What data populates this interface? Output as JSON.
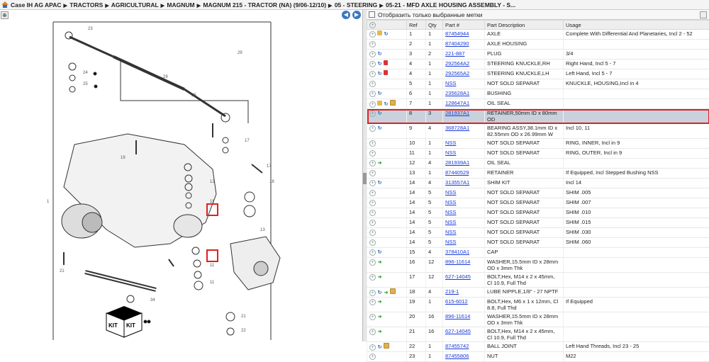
{
  "breadcrumb": [
    "Case IH AG APAC",
    "TRACTORS",
    "AGRICULTURAL",
    "MAGNUM",
    "MAGNUM 215 - TRACTOR (NA) (9/06-12/10)",
    "05 - STEERING",
    "05-21 - MFD AXLE HOUSING ASSEMBLY - S..."
  ],
  "filter_label": "Отобразить только выбранные метки",
  "columns": [
    "",
    "Ref",
    "Qty",
    "Part #",
    "Part Description",
    "Usage"
  ],
  "rows": [
    {
      "icons": [
        "folder",
        "blue"
      ],
      "ref": "1",
      "qty": "1",
      "part": "87454944",
      "desc": "AXLE",
      "usage": "Complete With Differential And Planetaries, Incl 2 - 52"
    },
    {
      "icons": [],
      "ref": "2",
      "qty": "1",
      "part": "87404290",
      "desc": "AXLE HOUSING",
      "usage": ""
    },
    {
      "icons": [
        "blue"
      ],
      "ref": "3",
      "qty": "2",
      "part": "221-887",
      "desc": "PLUG",
      "usage": "3/4"
    },
    {
      "icons": [
        "blue",
        "doc"
      ],
      "ref": "4",
      "qty": "1",
      "part": "292564A2",
      "desc": "STEERING KNUCKLE,RH",
      "usage": "Right Hand, Incl 5 - 7"
    },
    {
      "icons": [
        "blue",
        "doc"
      ],
      "ref": "4",
      "qty": "1",
      "part": "292565A2",
      "desc": "STEERING KNUCKLE,LH",
      "usage": "Left Hand, Incl 5 - 7"
    },
    {
      "icons": [],
      "ref": "5",
      "qty": "1",
      "part": "NSS",
      "desc": "NOT SOLD SEPARAT",
      "usage": "KNUCKLE, HOUSING,Incl in 4"
    },
    {
      "icons": [
        "blue"
      ],
      "ref": "6",
      "qty": "1",
      "part": "235628A1",
      "desc": "BUSHING",
      "usage": ""
    },
    {
      "icons": [
        "folder",
        "blue",
        "box"
      ],
      "ref": "7",
      "qty": "1",
      "part": "128647A1",
      "desc": "OIL SEAL",
      "usage": ""
    },
    {
      "icons": [
        "blue"
      ],
      "ref": "8",
      "qty": "3",
      "part": "281937A1",
      "desc": "RETAINER,50mm ID x 80mm OD",
      "usage": "",
      "selected": true
    },
    {
      "icons": [
        "blue"
      ],
      "ref": "9",
      "qty": "4",
      "part": "368728A1",
      "desc": "BEARING ASSY,38.1mm ID x 82.55mm OD x 26.99mm W",
      "usage": "Incl 10, 11"
    },
    {
      "icons": [],
      "ref": "10",
      "qty": "1",
      "part": "NSS",
      "desc": "NOT SOLD SEPARAT",
      "usage": "RING, INNER, Incl in 9"
    },
    {
      "icons": [],
      "ref": "11",
      "qty": "1",
      "part": "NSS",
      "desc": "NOT SOLD SEPARAT",
      "usage": "RING, OUTER, Incl in 9"
    },
    {
      "icons": [
        "green"
      ],
      "ref": "12",
      "qty": "4",
      "part": "281939A1",
      "desc": "OIL SEAL",
      "usage": ""
    },
    {
      "icons": [],
      "ref": "13",
      "qty": "1",
      "part": "87440529",
      "desc": "RETAINER",
      "usage": "If Equipped, Incl Stepped Bushing NSS"
    },
    {
      "icons": [
        "blue"
      ],
      "ref": "14",
      "qty": "4",
      "part": "313557A1",
      "desc": "SHIM KIT",
      "usage": "Incl 14"
    },
    {
      "icons": [],
      "ref": "14",
      "qty": "5",
      "part": "NSS",
      "desc": "NOT SOLD SEPARAT",
      "usage": "SHIM .005"
    },
    {
      "icons": [],
      "ref": "14",
      "qty": "5",
      "part": "NSS",
      "desc": "NOT SOLD SEPARAT",
      "usage": "SHIM .007"
    },
    {
      "icons": [],
      "ref": "14",
      "qty": "5",
      "part": "NSS",
      "desc": "NOT SOLD SEPARAT",
      "usage": "SHIM .010"
    },
    {
      "icons": [],
      "ref": "14",
      "qty": "5",
      "part": "NSS",
      "desc": "NOT SOLD SEPARAT",
      "usage": "SHIM .015"
    },
    {
      "icons": [],
      "ref": "14",
      "qty": "5",
      "part": "NSS",
      "desc": "NOT SOLD SEPARAT",
      "usage": "SHIM .030"
    },
    {
      "icons": [],
      "ref": "14",
      "qty": "5",
      "part": "NSS",
      "desc": "NOT SOLD SEPARAT",
      "usage": "SHIM .060"
    },
    {
      "icons": [
        "blue"
      ],
      "ref": "15",
      "qty": "4",
      "part": "378410A1",
      "desc": "CAP",
      "usage": ""
    },
    {
      "icons": [
        "green"
      ],
      "ref": "16",
      "qty": "12",
      "part": "896-11614",
      "desc": "WASHER,15.5mm ID x 28mm OD x 3mm Thk",
      "usage": ""
    },
    {
      "icons": [
        "green"
      ],
      "ref": "17",
      "qty": "12",
      "part": "627-14045",
      "desc": "BOLT,Hex, M14 x 2 x 45mm, Cl 10.9, Full Thd",
      "usage": ""
    },
    {
      "icons": [
        "blue",
        "green",
        "box"
      ],
      "ref": "18",
      "qty": "4",
      "part": "219-1",
      "desc": "LUBE NIPPLE,1/8\" - 27 NPTF",
      "usage": ""
    },
    {
      "icons": [
        "green"
      ],
      "ref": "19",
      "qty": "1",
      "part": "615-6012",
      "desc": "BOLT,Hex, M6 x 1 x 12mm, Cl 8.8, Full Thd",
      "usage": "If Equipped"
    },
    {
      "icons": [
        "green"
      ],
      "ref": "20",
      "qty": "16",
      "part": "896-11614",
      "desc": "WASHER,15.5mm ID x 28mm OD x 3mm Thk",
      "usage": ""
    },
    {
      "icons": [
        "green"
      ],
      "ref": "21",
      "qty": "16",
      "part": "627-14045",
      "desc": "BOLT,Hex, M14 x 2 x 45mm, Cl 10.9, Full Thd",
      "usage": ""
    },
    {
      "icons": [
        "blue",
        "box"
      ],
      "ref": "22",
      "qty": "1",
      "part": "87455742",
      "desc": "BALL JOINT",
      "usage": "Left Hand Threads, Incl 23 - 25"
    },
    {
      "icons": [],
      "ref": "23",
      "qty": "1",
      "part": "87455806",
      "desc": "NUT",
      "usage": "M22"
    }
  ],
  "diagram": {
    "callouts": [
      "1",
      "2",
      "3",
      "4",
      "5",
      "6",
      "7",
      "8",
      "9",
      "10",
      "11",
      "12",
      "13",
      "14",
      "15",
      "16",
      "17",
      "18",
      "19",
      "20",
      "21",
      "22",
      "23",
      "24",
      "25",
      "26",
      "27",
      "28",
      "29",
      "30",
      "31",
      "32",
      "33",
      "34",
      "35",
      "36",
      "37",
      "38",
      "39",
      "40",
      "41",
      "42",
      "43",
      "44",
      "45",
      "46",
      "47",
      "48",
      "49",
      "50",
      "51",
      "52"
    ],
    "kit_label": "KIT"
  }
}
